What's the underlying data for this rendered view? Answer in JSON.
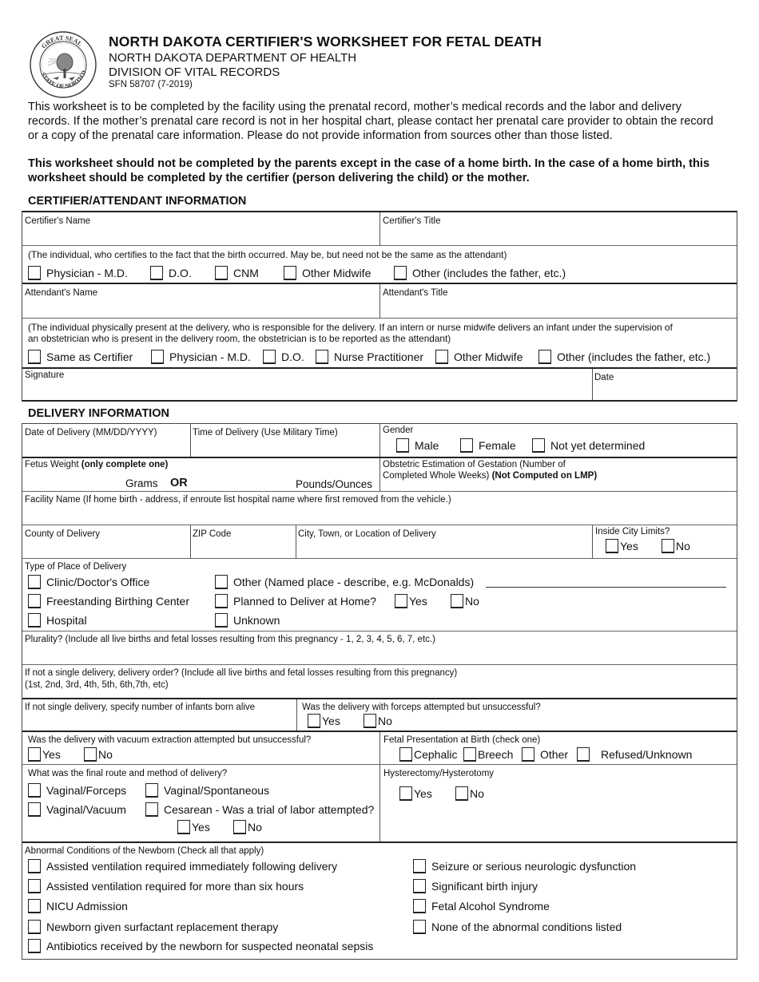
{
  "header": {
    "seal_icon": "great-seal-north-dakota",
    "title": "NORTH DAKOTA CERTIFIER'S WORKSHEET FOR FETAL DEATH",
    "department": "NORTH DAKOTA DEPARTMENT OF HEALTH",
    "division": "DIVISION OF VITAL RECORDS",
    "form_number": "SFN 58707 (7-2019)"
  },
  "intro": {
    "text": "This worksheet is to be completed by the facility using the prenatal record, mother’s medical records and the labor and delivery\nrecords.  If the mother’s prenatal care record is not in her hospital chart, please contact her prenatal care provider to obtain the record\nor a copy of the prenatal care information.  Please do not provide information from sources other than those listed.",
    "bold_text": "This worksheet should not be completed by the parents except in the case of a home birth.  In the case of a home birth, this\nworksheet should be completed by the certifier (person delivering the child) or the mother."
  },
  "certifier_section": {
    "title": "CERTIFIER/ATTENDANT INFORMATION",
    "certifier_name_label": "Certifier's Name",
    "certifier_title_label": "Certifier's Title",
    "certifier_note": "(The individual, who certifies to the fact that the birth occurred.  May be, but need not be the same as the attendant)",
    "certifier_options": [
      "Physician - M.D.",
      "D.O.",
      "CNM",
      "Other Midwife",
      "Other (includes the father, etc.)"
    ],
    "attendant_name_label": "Attendant's Name",
    "attendant_title_label": "Attendant's Title",
    "attendant_note_line1": "(The individual physically present at the delivery, who is responsible for the delivery.  If an intern or nurse midwife delivers an infant under the supervision of",
    "attendant_note_line2": "an obstetrician who is present in the delivery room, the obstetrician is to be reported as the attendant)",
    "attendant_options": [
      "Same as Certifier",
      "Physician - M.D.",
      "D.O.",
      "Nurse Practitioner",
      "Other Midwife",
      "Other (includes the father, etc.)"
    ],
    "signature_label": "Signature",
    "date_label": "Date"
  },
  "delivery_section": {
    "title": "DELIVERY INFORMATION",
    "date_label": "Date of Delivery (MM/DD/YYYY)",
    "time_label": "Time of Delivery (Use Military Time)",
    "gender_label": "Gender",
    "gender_options": [
      "Male",
      "Female",
      "Not yet determined"
    ],
    "weight_label": "Fetus Weight ",
    "weight_label_bold": "(only complete one)",
    "grams_label": "Grams",
    "or_label": "OR",
    "pounds_label": "Pounds/Ounces",
    "gestation_label_line1": "Obstetric Estimation of Gestation (Number of",
    "gestation_label_line2": "Completed Whole Weeks) ",
    "gestation_label_bold": "(Not Computed on LMP)",
    "facility_label": "Facility Name  (If home birth - address, if enroute list hospital name where first removed from the vehicle.)",
    "county_label": "County of Delivery",
    "zip_label": "ZIP Code",
    "city_label": "City, Town, or Location of Delivery",
    "city_limits_label": "Inside City Limits?",
    "city_limits_options": [
      "Yes",
      "No"
    ],
    "place_type_label": "Type of Place of Delivery",
    "place_options_col1": [
      "Clinic/Doctor's Office",
      "Freestanding Birthing Center",
      "Hospital"
    ],
    "place_options_col2": [
      "Other (Named place - describe, e.g. McDonalds)",
      "Planned to Deliver at Home?",
      "Unknown"
    ],
    "planned_home_options": [
      "Yes",
      "No"
    ],
    "plurality_label": "Plurality?  (Include all live births and fetal losses resulting from this pregnancy - 1, 2, 3, 4, 5, 6, 7, etc.)",
    "order_label_line1": "If not a single delivery, delivery order? (Include all live births and fetal losses resulting from this pregnancy)",
    "order_label_line2": "(1st, 2nd, 3rd, 4th, 5th, 6th,7th, etc)",
    "born_alive_label": "If not single delivery, specify number of infants born alive",
    "forceps_label": "Was the delivery with forceps attempted but unsuccessful?",
    "forceps_options": [
      "Yes",
      "No"
    ],
    "vacuum_label": "Was the delivery with vacuum extraction attempted but unsuccessful?",
    "vacuum_options": [
      "Yes",
      "No"
    ],
    "presentation_label": "Fetal Presentation at Birth (check one)",
    "presentation_options": [
      "Cephalic",
      "Breech",
      "Other",
      "Refused/Unknown"
    ],
    "route_label": "What was the final route and method of delivery?",
    "route_options": [
      "Vaginal/Forceps",
      "Vaginal/Spontaneous",
      "Vaginal/Vacuum",
      "Cesarean - Was a trial of labor attempted?"
    ],
    "trial_labor_options": [
      "Yes",
      "No"
    ],
    "hysterectomy_label": "Hysterectomy/Hysterotomy",
    "hysterectomy_options": [
      "Yes",
      "No"
    ],
    "abnormal_label": "Abnormal Conditions of the Newborn (Check all that apply)",
    "abnormal_col1": [
      "Assisted ventilation required immediately following delivery",
      "Assisted ventilation required for more than six hours",
      "NICU Admission",
      "Newborn given surfactant replacement therapy",
      "Antibiotics received by the newborn for suspected neonatal sepsis"
    ],
    "abnormal_col2": [
      "Seizure or serious neurologic dysfunction",
      "Significant birth injury",
      "Fetal Alcohol Syndrome",
      "None of the abnormal conditions listed"
    ]
  }
}
